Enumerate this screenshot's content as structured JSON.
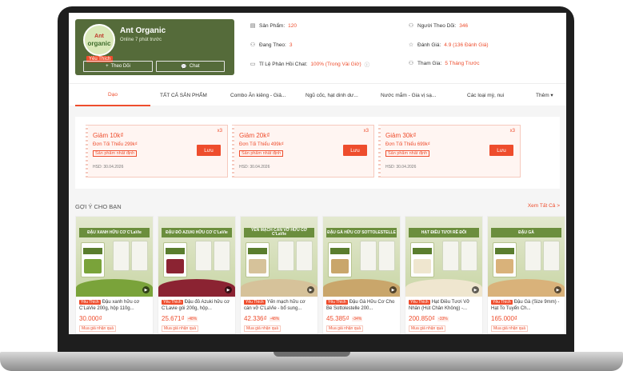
{
  "shop": {
    "name": "Ant Organic",
    "online": "Online 7 phút trước",
    "logo_top": "Ant",
    "logo_bottom": "organic",
    "favorite_badge": "Yêu Thích",
    "follow_label": "Theo Dõi",
    "chat_label": "Chat"
  },
  "stats": {
    "products_label": "Sản Phẩm:",
    "products_value": "120",
    "following_label": "Đang Theo:",
    "following_value": "3",
    "response_label": "Tỉ Lệ Phản Hồi Chat:",
    "response_value": "100% (Trong Vài Giờ)",
    "followers_label": "Người Theo Dõi:",
    "followers_value": "346",
    "rating_label": "Đánh Giá:",
    "rating_value": "4.9 (136 Đánh Giá)",
    "joined_label": "Tham Gia:",
    "joined_value": "5 Tháng Trước"
  },
  "tabs": [
    "Dạo",
    "TẤT CẢ SẢN PHẨM",
    "Combo Ăn kiêng - Giả...",
    "Ngũ cốc, hạt dinh dư...",
    "Nước mắm - Gia vị sạ...",
    "Các loại mỳ, nui",
    "Thêm ▾"
  ],
  "vouchers": [
    {
      "title": "Giảm 10k₫",
      "min": "Đơn Tối Thiểu 299k₫",
      "tag": "Sản phẩm nhất định",
      "expiry": "HSD: 30.04.2026",
      "qty": "x3",
      "save": "Lưu"
    },
    {
      "title": "Giảm 20k₫",
      "min": "Đơn Tối Thiểu 499k₫",
      "tag": "Sản phẩm nhất định",
      "expiry": "HSD: 30.04.2026",
      "qty": "x3",
      "save": "Lưu"
    },
    {
      "title": "Giảm 30k₫",
      "min": "Đơn Tối Thiểu 699k₫",
      "tag": "Sản phẩm nhất định",
      "expiry": "HSD: 30.04.2026",
      "qty": "x3",
      "save": "Lưu"
    }
  ],
  "recommend": {
    "title": "GỢI Ý CHO BẠN",
    "see_all": "Xem Tất Cả >"
  },
  "products": [
    {
      "banner": "ĐẬU XANH HỮU CƠ C'LaVie",
      "fav": "Yêu Thích",
      "name": "Đậu xanh hữu cơ C'LaVie 200g, hộp 110g...",
      "price": "30.000₫",
      "discount": "",
      "buy": "Mua giá nhận quà",
      "color": "#7aa33a"
    },
    {
      "banner": "ĐẬU ĐỎ AZUKI HỮU CƠ C'LaVie",
      "fav": "Yêu Thích",
      "name": "Đậu đỏ Azuki hữu cơ C'Lavie gói 200g, hộp...",
      "price": "25.671₫",
      "discount": "-48%",
      "buy": "Mua giá nhận quà",
      "color": "#8b2332"
    },
    {
      "banner": "YẾN MẠCH CÁN VỠ HỮU CƠ C'LaVie",
      "fav": "Yêu Thích",
      "name": "Yến mạch hữu cơ cán vỡ C'LaVie - bổ sung...",
      "price": "42.336₫",
      "discount": "-48%",
      "buy": "Mua giá nhận quà",
      "color": "#d6c29a"
    },
    {
      "banner": "ĐẬU GÀ HỮU CƠ SOTTOLESTELLE",
      "fav": "Yêu Thích",
      "name": "Đậu Gà Hữu Cơ Cho Bé Sottolestelle 200...",
      "price": "45.385₫",
      "discount": "-34%",
      "buy": "Mua giá nhận quà",
      "color": "#c9a66b"
    },
    {
      "banner": "HẠT ĐIỀU TƯƠI RỄ ĐÔI",
      "fav": "Yêu Thích",
      "name": "Hạt Điều Tươi Vỡ Nhân (Hút Chân Không) -...",
      "price": "200.850₫",
      "discount": "-33%",
      "buy": "Mua giá nhận quà",
      "color": "#efe6cf"
    },
    {
      "banner": "ĐẬU GÀ",
      "fav": "Yêu Thích",
      "name": "Đậu Gà (Size 9mm) - Hạt To Tuyển Ch...",
      "price": "165.000₫",
      "discount": "",
      "buy": "Mua giá nhận quà",
      "color": "#d9b27a"
    }
  ]
}
